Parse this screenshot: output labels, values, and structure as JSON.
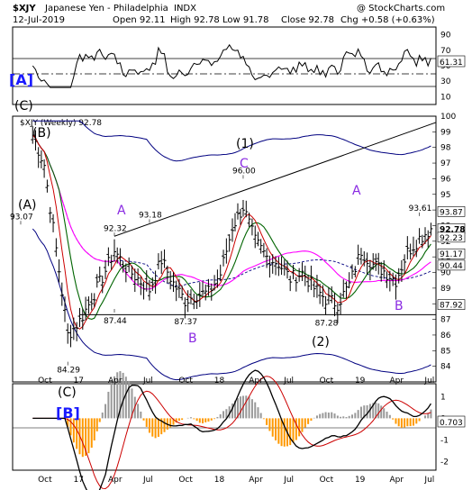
{
  "header": {
    "symbol": "$XJY",
    "name": "Japanese Yen - Philadelphia",
    "exchange": "INDX",
    "watermark": "@ StockCharts.com",
    "date": "12-Jul-2019",
    "open": "Open 92.11",
    "high": "High 92.78",
    "low": "Low 91.78",
    "close": "Close 92.78",
    "chg": "Chg +0.58 (+0.63%)"
  },
  "rsi": {
    "label_value": "61.31",
    "ticks": [
      "90",
      "70",
      "50",
      "30",
      "10"
    ]
  },
  "price": {
    "legend": "$XJY (Weekly) 92.78",
    "axis_ticks": [
      "100",
      "99",
      "98",
      "97",
      "96",
      "95",
      "94",
      "93",
      "92",
      "91",
      "90",
      "89",
      "88",
      "87",
      "86",
      "85",
      "84"
    ],
    "right_labels": [
      "93.87",
      "92.78",
      "92.23",
      "91.17",
      "90.44",
      "87.92"
    ],
    "annotations": [
      "93.07",
      "84.29",
      "92.32",
      "93.18",
      "87.44",
      "87.37",
      "96.00",
      "87.28",
      "93.61"
    ]
  },
  "macd": {
    "label_value": "0.703",
    "ticks": [
      "1",
      "0",
      "-1",
      "-2"
    ]
  },
  "x_labels": [
    "Oct",
    "17",
    "Apr",
    "Jul",
    "Oct",
    "18",
    "Apr",
    "Jul",
    "Oct",
    "19",
    "Apr",
    "Jul"
  ],
  "waves": {
    "A_box": "[A]",
    "C_top": "(C)",
    "B_paren": "(B)",
    "A_paren": "(A)",
    "A1": "A",
    "B1": "B",
    "one": "(1)",
    "C1": "C",
    "A2": "A",
    "two": "(2)",
    "B2": "B",
    "C_macd": "(C)",
    "B_box": "[B]"
  },
  "colors": {
    "price": "#000000",
    "ma_fast": "#cc0000",
    "ma_mid": "#006400",
    "ma_slow": "#ff00ff",
    "band": "#000080",
    "histogram": "#ff9900",
    "wave_purple": "#8a2be2",
    "wave_blue": "#1a1aff"
  },
  "chart_data": {
    "type": "line",
    "title": "$XJY Japanese Yen - Philadelphia (Weekly)",
    "x": [
      "2016-09",
      "2016-10",
      "2016-11",
      "2016-12",
      "2017-01",
      "2017-02",
      "2017-03",
      "2017-04",
      "2017-05",
      "2017-06",
      "2017-07",
      "2017-08",
      "2017-09",
      "2017-10",
      "2017-11",
      "2017-12",
      "2018-01",
      "2018-02",
      "2018-03",
      "2018-04",
      "2018-05",
      "2018-06",
      "2018-07",
      "2018-08",
      "2018-09",
      "2018-10",
      "2018-11",
      "2018-12",
      "2019-01",
      "2019-02",
      "2019-03",
      "2019-04",
      "2019-05",
      "2019-06",
      "2019-07"
    ],
    "ylim": [
      83,
      100
    ],
    "series": [
      {
        "name": "$XJY",
        "values": [
          98.8,
          96.9,
          91.5,
          86.0,
          86.9,
          88.3,
          89.7,
          91.4,
          90.3,
          89.6,
          88.9,
          90.8,
          89.3,
          88.2,
          88.6,
          88.7,
          89.9,
          92.9,
          94.2,
          92.0,
          91.0,
          90.6,
          89.6,
          90.0,
          89.0,
          88.3,
          88.0,
          89.2,
          91.4,
          90.5,
          90.1,
          89.5,
          91.3,
          92.2,
          92.8
        ]
      }
    ],
    "annotations": [
      {
        "x": "2016-08",
        "y": 93.07
      },
      {
        "x": "2016-12",
        "y": 84.29
      },
      {
        "x": "2017-04",
        "y": 92.32
      },
      {
        "x": "2017-07",
        "y": 93.18
      },
      {
        "x": "2017-04",
        "y": 87.44
      },
      {
        "x": "2017-10",
        "y": 87.37
      },
      {
        "x": "2018-03",
        "y": 96.0
      },
      {
        "x": "2018-10",
        "y": 87.28
      },
      {
        "x": "2019-06",
        "y": 93.61
      }
    ],
    "trend_line": [
      {
        "x": "2017-04",
        "y": 92.32
      },
      {
        "x": "2019-08",
        "y": 99.6
      }
    ],
    "support_line": 87.3,
    "rsi_ylim": [
      0,
      100
    ],
    "macd_ylim": [
      -2.4,
      1.6
    ]
  }
}
